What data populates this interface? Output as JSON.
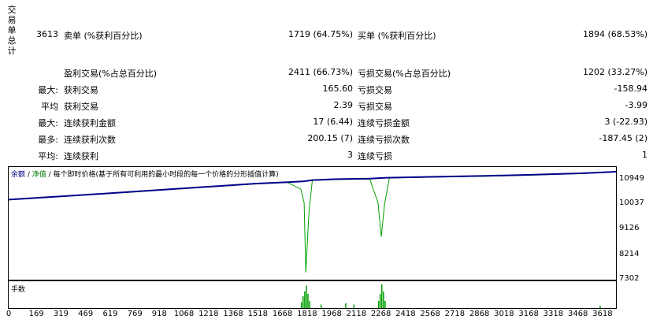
{
  "vertical_label": "交易单总计",
  "summary": {
    "total": "3613",
    "short_label": "卖单 (%获利百分比)",
    "short_value": "1719 (64.75%)",
    "long_label": "买单 (%获利百分比)",
    "long_value": "1894 (68.53%)"
  },
  "stats_rows": [
    {
      "prefix": "",
      "label": "盈利交易(%占总百分比)",
      "value": "2411 (66.73%)",
      "label2": "亏损交易(%占总百分比)",
      "value2": "1202 (33.27%)"
    },
    {
      "prefix": "最大:",
      "label": "获利交易",
      "value": "165.60",
      "label2": "亏损交易",
      "value2": "-158.94"
    },
    {
      "prefix": "平均",
      "label": "获利交易",
      "value": "2.39",
      "label2": "亏损交易",
      "value2": "-3.99"
    },
    {
      "prefix": "最大:",
      "label": "连续获利金额",
      "value": "17 (6.44)",
      "label2": "连续亏损金额",
      "value2": "3 (-22.93)"
    },
    {
      "prefix": "最多:",
      "label": "连续获利次数",
      "value": "200.15 (7)",
      "label2": "连续亏损次数",
      "value2": "-187.45 (2)"
    },
    {
      "prefix": "平均:",
      "label": "连续获利",
      "value": "3",
      "label2": "连续亏损",
      "value2": "1"
    }
  ],
  "chart_header": {
    "balance": "余额",
    "sep1": " / ",
    "equity": "净值",
    "rest": " / 每个即时价格(基于所有可利用的最小时段的每一个价格的分形插值计算)"
  },
  "lots_header": "手数",
  "colors": {
    "balance": "#00008b",
    "equity": "#00a000",
    "lots": "#00a000"
  },
  "chart_data": {
    "type": "line",
    "series": [
      {
        "name": "余额",
        "x": [
          0,
          300,
          600,
          900,
          1200,
          1500,
          1700,
          1800,
          1850,
          2000,
          2200,
          2300,
          2600,
          2900,
          3200,
          3500,
          3700
        ],
        "values": [
          10000,
          10105,
          10210,
          10320,
          10430,
          10540,
          10590,
          10620,
          10660,
          10690,
          10710,
          10740,
          10770,
          10800,
          10840,
          10890,
          10940
        ]
      },
      {
        "name": "净值",
        "x": [
          0,
          300,
          600,
          900,
          1200,
          1500,
          1700,
          1780,
          1800,
          1810,
          1830,
          1850,
          2000,
          2200,
          2250,
          2270,
          2290,
          2320,
          2600,
          2900,
          3200,
          3500,
          3700
        ],
        "values": [
          9990,
          10100,
          10200,
          10310,
          10420,
          10530,
          10580,
          10350,
          9900,
          7550,
          9600,
          10650,
          10680,
          10690,
          9900,
          8750,
          9850,
          10730,
          10760,
          10790,
          10830,
          10880,
          10935
        ]
      }
    ],
    "lots": {
      "name": "手数",
      "x": [
        1780,
        1790,
        1800,
        1810,
        1820,
        1830,
        1900,
        2050,
        2100,
        2250,
        2260,
        2270,
        2280,
        2290,
        3600
      ],
      "values": [
        0.25,
        0.5,
        0.7,
        0.95,
        0.6,
        0.3,
        0.15,
        0.2,
        0.15,
        0.3,
        0.6,
        1.0,
        0.7,
        0.3,
        0.1
      ]
    },
    "xticks": [
      "0",
      "169",
      "319",
      "469",
      "619",
      "769",
      "918",
      "1068",
      "1218",
      "1368",
      "1518",
      "1668",
      "1818",
      "1968",
      "2118",
      "2268",
      "2418",
      "2568",
      "2718",
      "2868",
      "3018",
      "3168",
      "3318",
      "3468",
      "3618"
    ],
    "yticks": [
      "10949",
      "10037",
      "9126",
      "8214",
      "7302"
    ],
    "xlim": [
      0,
      3700
    ],
    "ylim": [
      7302,
      11100
    ],
    "grid": false
  }
}
